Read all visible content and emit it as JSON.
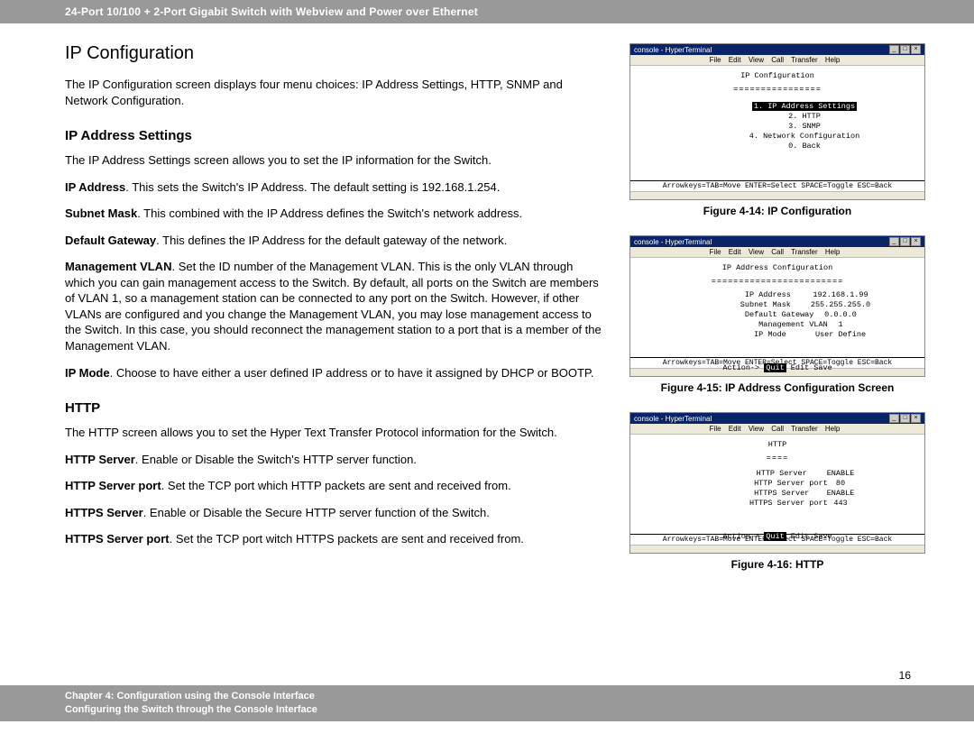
{
  "header": "24-Port 10/100 + 2-Port Gigabit Switch with Webview and Power over Ethernet",
  "section": {
    "title": "IP Configuration",
    "intro": "The IP Configuration screen displays four menu choices: IP Address Settings, HTTP, SNMP and Network Configuration.",
    "ip_settings": {
      "title": "IP Address Settings",
      "intro": "The IP Address Settings screen allows you to set the IP information for the Switch.",
      "ip_address_label": "IP Address",
      "ip_address_text": ". This sets the Switch's IP Address. The default setting is 192.168.1.254.",
      "subnet_label": "Subnet Mask",
      "subnet_text": ". This combined with the IP Address defines the Switch's network address.",
      "gateway_label": "Default Gateway",
      "gateway_text": ". This defines the IP Address for the default gateway of the network.",
      "vlan_label": "Management VLAN",
      "vlan_text": ". Set the ID number of the Management VLAN. This is the only VLAN through which you can gain management access to the Switch. By default, all ports on the Switch are members of VLAN 1, so a management station can be connected to any port on the Switch. However, if other VLANs are configured and you change the Management VLAN, you may lose management access to the Switch. In this case, you should reconnect the management station to a port that is a member of the Management VLAN.",
      "ipmode_label": "IP Mode",
      "ipmode_text": ". Choose to have either a user defined IP address or to have it assigned by DHCP or BOOTP."
    },
    "http": {
      "title": "HTTP",
      "intro": "The HTTP screen allows you to set the Hyper Text Transfer Protocol information for the Switch.",
      "server_label": "HTTP Server",
      "server_text": ". Enable or Disable the Switch's HTTP server function.",
      "port_label": "HTTP Server port",
      "port_text": ". Set the TCP port which HTTP packets are sent and received from.",
      "https_label": "HTTPS Server",
      "https_text": ". Enable or Disable the Secure HTTP server function of the Switch.",
      "https_port_label": "HTTPS Server port",
      "https_port_text": ". Set the TCP port witch HTTPS packets are sent and received from."
    }
  },
  "figures": {
    "fig1": {
      "caption": "Figure 4-14: IP Configuration",
      "title_app": "console - HyperTerminal",
      "menu_items": [
        "File",
        "Edit",
        "View",
        "Call",
        "Transfer",
        "Help"
      ],
      "screen_title": "IP Configuration",
      "items": [
        "1. IP Address Settings",
        "2. HTTP",
        "3. SNMP",
        "4. Network Configuration",
        "0. Back"
      ],
      "status": "Arrowkeys=TAB=Move  ENTER=Select  SPACE=Toggle  ESC=Back"
    },
    "fig2": {
      "caption": "Figure 4-15: IP Address Configuration Screen",
      "screen_title": "IP Address Configuration",
      "rows": [
        {
          "k": "IP Address",
          "v": "192.168.1.99"
        },
        {
          "k": "Subnet Mask",
          "v": "255.255.255.0"
        },
        {
          "k": "Default Gateway",
          "v": "0.0.0.0"
        },
        {
          "k": "Management VLAN",
          "v": "1"
        },
        {
          "k": "IP Mode",
          "v": "User Define"
        }
      ],
      "action_row": "Action->  Quit   Edit   Save",
      "status": "Arrowkeys=TAB=Move  ENTER=Select  SPACE=Toggle  ESC=Back"
    },
    "fig3": {
      "caption": "Figure 4-16: HTTP",
      "screen_title": "HTTP",
      "rows": [
        {
          "k": "HTTP Server",
          "v": "ENABLE"
        },
        {
          "k": "HTTP Server port",
          "v": "80"
        },
        {
          "k": "HTTPS Server",
          "v": "ENABLE"
        },
        {
          "k": "HTTPS Server port",
          "v": "443"
        }
      ],
      "action_row": "Action->  Quit   Edit   Save",
      "status": "Arrowkeys=TAB=Move  ENTER=Select  SPACE=Toggle  ESC=Back"
    }
  },
  "page_number": "16",
  "footer_line1": "Chapter 4: Configuration using the Console Interface",
  "footer_line2": "Configuring the Switch through the Console Interface"
}
